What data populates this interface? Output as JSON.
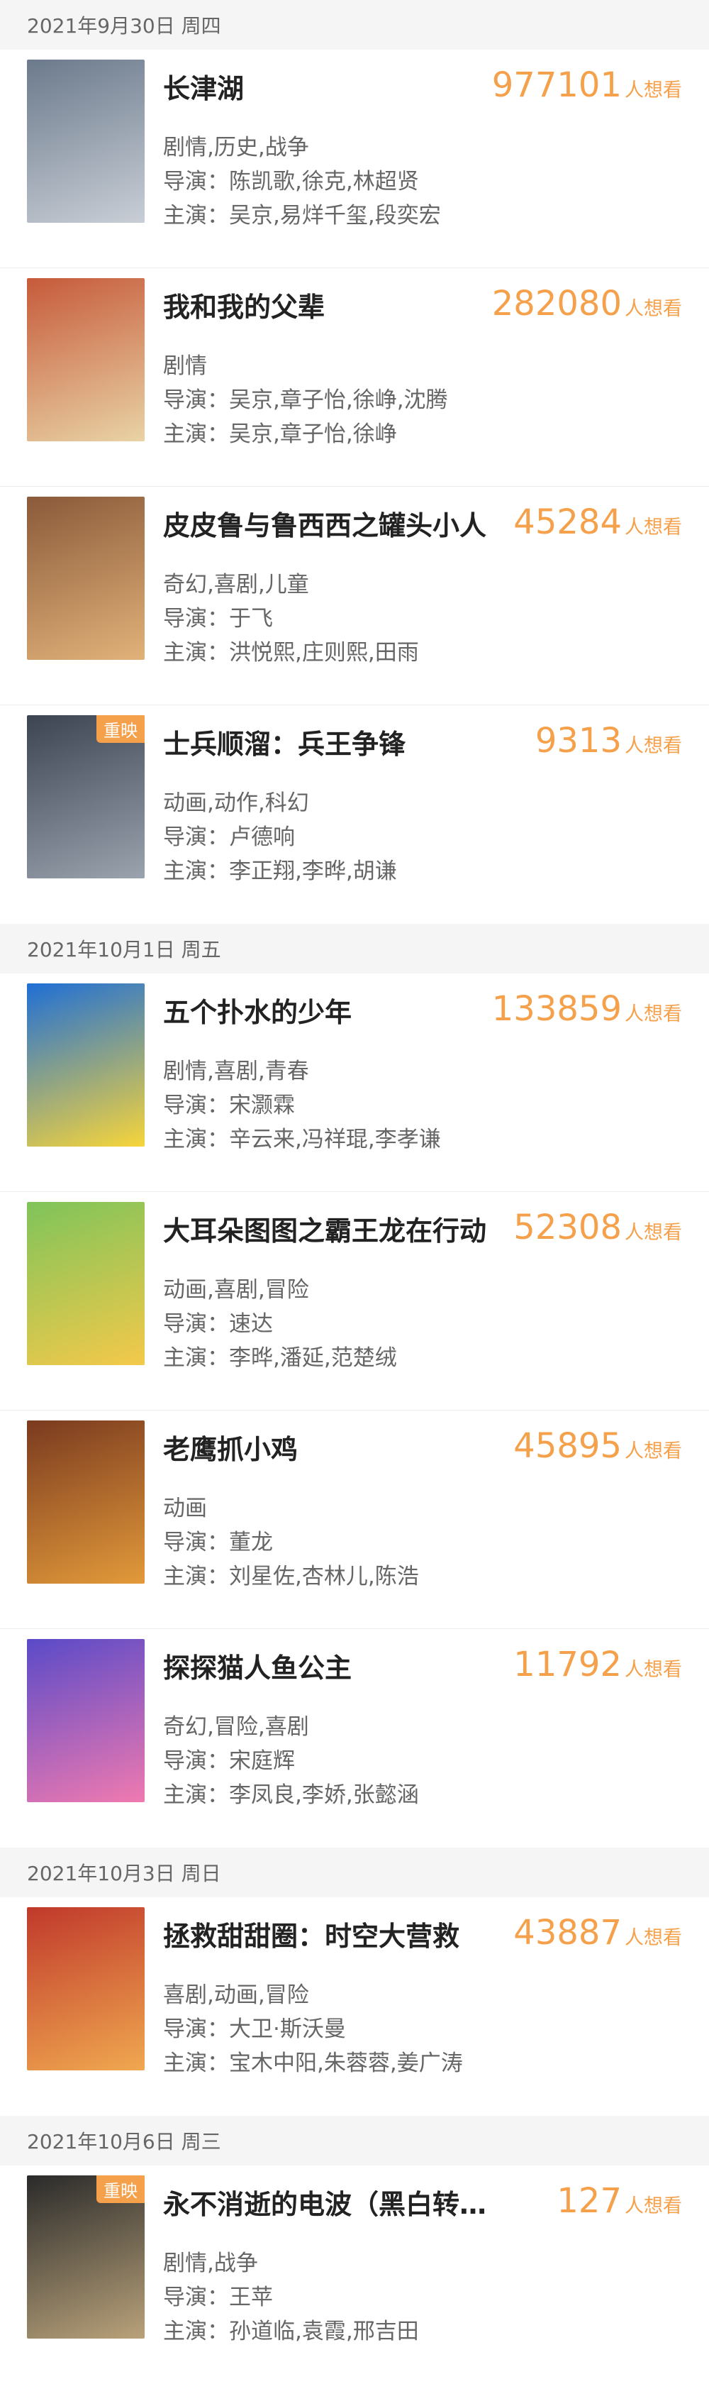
{
  "labels": {
    "director_prefix": "导演：",
    "cast_prefix": "主演：",
    "wish_unit": "人想看",
    "rerelease_tag": "重映"
  },
  "groups": [
    {
      "date": "2021年9月30日 周四",
      "movies": [
        {
          "title": "长津湖",
          "wish": "977101",
          "genre": "剧情,历史,战争",
          "director": "陈凯歌,徐克,林超贤",
          "cast": "吴京,易烊千玺,段奕宏",
          "tag": "",
          "poster_colors": [
            "#6b7a8c",
            "#c9ced6"
          ]
        },
        {
          "title": "我和我的父辈",
          "wish": "282080",
          "genre": "剧情",
          "director": "吴京,章子怡,徐峥,沈腾",
          "cast": "吴京,章子怡,徐峥",
          "tag": "",
          "poster_colors": [
            "#c65a3a",
            "#e9d3a6"
          ]
        },
        {
          "title": "皮皮鲁与鲁西西之罐头小人",
          "wish": "45284",
          "genre": "奇幻,喜剧,儿童",
          "director": "于飞",
          "cast": "洪悦熙,庄则熙,田雨",
          "tag": "",
          "poster_colors": [
            "#8a5a3a",
            "#e2b27a"
          ]
        },
        {
          "title": "士兵顺溜：兵王争锋",
          "wish": "9313",
          "genre": "动画,动作,科幻",
          "director": "卢德响",
          "cast": "李正翔,李晔,胡谦",
          "tag": "重映",
          "poster_colors": [
            "#3c4452",
            "#9aa3ae"
          ]
        }
      ]
    },
    {
      "date": "2021年10月1日 周五",
      "movies": [
        {
          "title": "五个扑水的少年",
          "wish": "133859",
          "genre": "剧情,喜剧,青春",
          "director": "宋灏霖",
          "cast": "辛云来,冯祥琨,李孝谦",
          "tag": "",
          "poster_colors": [
            "#1f6fd6",
            "#f7d53a"
          ]
        },
        {
          "title": "大耳朵图图之霸王龙在行动",
          "wish": "52308",
          "genre": "动画,喜剧,冒险",
          "director": "速达",
          "cast": "李晔,潘延,范楚绒",
          "tag": "",
          "poster_colors": [
            "#7fc45a",
            "#f4c94a"
          ]
        },
        {
          "title": "老鹰抓小鸡",
          "wish": "45895",
          "genre": "动画",
          "director": "董龙",
          "cast": "刘星佐,杏林儿,陈浩",
          "tag": "",
          "poster_colors": [
            "#7a3a1f",
            "#e39a3a"
          ]
        },
        {
          "title": "探探猫人鱼公主",
          "wish": "11792",
          "genre": "奇幻,冒险,喜剧",
          "director": "宋庭辉",
          "cast": "李凤良,李娇,张懿涵",
          "tag": "",
          "poster_colors": [
            "#5a4ac8",
            "#f07ab0"
          ]
        }
      ]
    },
    {
      "date": "2021年10月3日 周日",
      "movies": [
        {
          "title": "拯救甜甜圈：时空大营救",
          "wish": "43887",
          "genre": "喜剧,动画,冒险",
          "director": "大卫·斯沃曼",
          "cast": "宝木中阳,朱蓉蓉,姜广涛",
          "tag": "",
          "poster_colors": [
            "#c0392b",
            "#f0a850"
          ]
        }
      ]
    },
    {
      "date": "2021年10月6日 周三",
      "movies": [
        {
          "title": "永不消逝的电波（黑白转彩色版）",
          "wish": "127",
          "genre": "剧情,战争",
          "director": "王苹",
          "cast": "孙道临,袁霞,邢吉田",
          "tag": "重映",
          "poster_colors": [
            "#2a2a2a",
            "#b9a27a"
          ]
        }
      ]
    }
  ]
}
